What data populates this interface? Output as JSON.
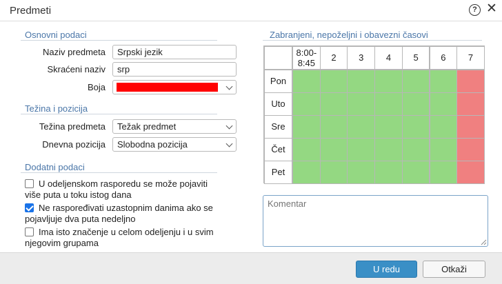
{
  "dialog": {
    "title": "Predmeti"
  },
  "basic": {
    "section_title": "Osnovni podaci",
    "name_label": "Naziv predmeta",
    "name_value": "Srpski jezik",
    "short_label": "Skraćeni naziv",
    "short_value": "srp",
    "color_label": "Boja",
    "color_value": "#ff0000"
  },
  "weight": {
    "section_title": "Težina i pozicija",
    "weight_label": "Težina predmeta",
    "weight_value": "Težak predmet",
    "position_label": "Dnevna pozicija",
    "position_value": "Slobodna pozicija"
  },
  "extra": {
    "section_title": "Dodatni podaci",
    "options": [
      {
        "label": "U odeljenskom rasporedu se može pojaviti više puta u toku istog dana",
        "checked": false
      },
      {
        "label": "Ne raspoređivati uzastopnim danima ako se pojavljuje dva puta nedeljno",
        "checked": true
      },
      {
        "label": "Ima isto značenje u celom odeljenju i u svim njegovim grupama",
        "checked": false
      }
    ]
  },
  "schedule": {
    "section_title": "Zabranjeni, nepoželjni i obavezni časovi",
    "periods": [
      "8:00-\n8:45",
      "2",
      "3",
      "4",
      "5",
      "6",
      "7"
    ],
    "days": [
      "Pon",
      "Uto",
      "Sre",
      "Čet",
      "Pet"
    ],
    "states": [
      [
        "ok",
        "ok",
        "ok",
        "ok",
        "ok",
        "ok",
        "bad"
      ],
      [
        "ok",
        "ok",
        "ok",
        "ok",
        "ok",
        "ok",
        "bad"
      ],
      [
        "ok",
        "ok",
        "ok",
        "ok",
        "ok",
        "ok",
        "bad"
      ],
      [
        "ok",
        "ok",
        "ok",
        "ok",
        "ok",
        "ok",
        "bad"
      ],
      [
        "ok",
        "ok",
        "ok",
        "ok",
        "ok",
        "ok",
        "bad"
      ]
    ],
    "colors": {
      "ok": "#94d882",
      "bad": "#f08080"
    }
  },
  "comment": {
    "placeholder": "Komentar",
    "value": ""
  },
  "buttons": {
    "ok": "U redu",
    "cancel": "Otkaži"
  },
  "icons": {
    "help": "help-icon",
    "close": "close-icon",
    "dropdown": "chevron-down-icon",
    "resize": "resize-grip-icon"
  }
}
